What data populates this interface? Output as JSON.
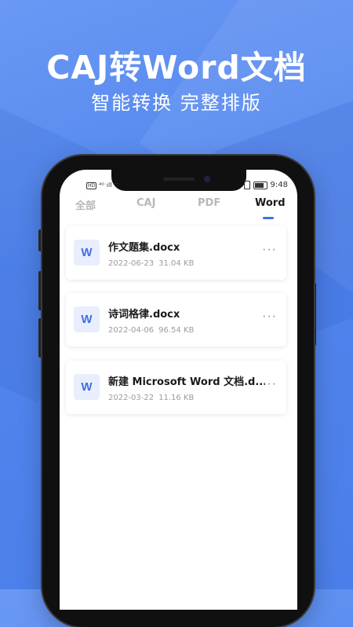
{
  "promo": {
    "headline": "CAJ转Word文档",
    "subline": "智能转换 完整排版"
  },
  "status_bar": {
    "left_icons": "HD ⁴ᴳ",
    "time": "9:48"
  },
  "tabs": [
    {
      "label": "全部",
      "active": false
    },
    {
      "label": "CAJ",
      "active": false
    },
    {
      "label": "PDF",
      "active": false
    },
    {
      "label": "Word",
      "active": true
    }
  ],
  "files": [
    {
      "icon_letter": "W",
      "name": "作文题集.docx",
      "date": "2022-06-23",
      "size": "31.04 KB"
    },
    {
      "icon_letter": "W",
      "name": "诗词格律.docx",
      "date": "2022-04-06",
      "size": "96.54 KB"
    },
    {
      "icon_letter": "W",
      "name": "新建 Microsoft Word 文档.d...",
      "date": "2022-03-22",
      "size": "11.16 KB"
    }
  ],
  "more_glyph": "···",
  "colors": {
    "background": "#5286ee",
    "accent": "#3c71ea",
    "file_icon_bg": "#e9eefc"
  },
  "icons": [
    "word-file-icon",
    "more-icon",
    "battery-icon",
    "vibrate-icon",
    "signal-icon"
  ]
}
